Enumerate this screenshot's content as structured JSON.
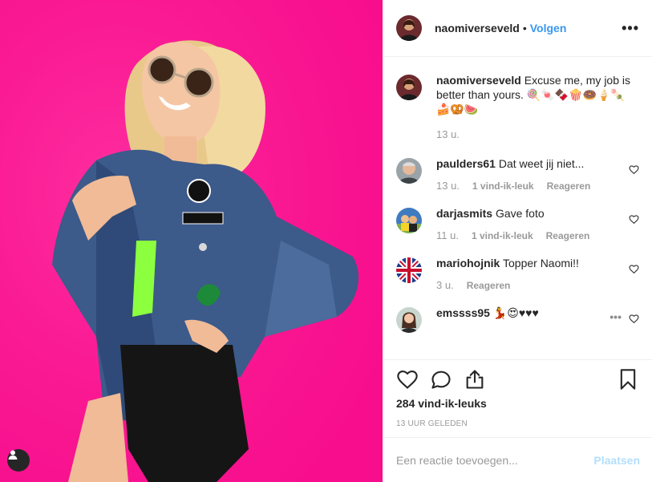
{
  "header": {
    "username": "naomiverseveld",
    "dot": "•",
    "follow_label": "Volgen",
    "more_label": "•••"
  },
  "caption": {
    "username": "naomiverseveld",
    "text": "Excuse me, my job is better than yours. 🍭🍬🍫🍿🍩🍦🍡🍰🥨🍉",
    "time": "13 u."
  },
  "comments": [
    {
      "username": "paulders61",
      "text": "Dat weet jij niet...",
      "time": "13 u.",
      "likes": "1 vind-ik-leuk",
      "reply": "Reageren"
    },
    {
      "username": "darjasmits",
      "text": "Gave foto",
      "time": "11 u.",
      "likes": "1 vind-ik-leuk",
      "reply": "Reageren"
    },
    {
      "username": "mariohojnik",
      "text": "Topper Naomi!!",
      "time": "3 u.",
      "reply": "Reageren"
    },
    {
      "username": "emssss95",
      "text": "💃😍♥♥♥"
    }
  ],
  "comment_more": "•••",
  "likes_text": "284 vind-ik-leuks",
  "timestamp": "13 UUR GELEDEN",
  "add_comment": {
    "placeholder": "Een reactie toevoegen...",
    "post_label": "Plaatsen"
  },
  "icons": {
    "like": "heart-icon",
    "comment": "comment-icon",
    "share": "share-icon",
    "save": "bookmark-icon",
    "tag": "user-icon"
  },
  "colors": {
    "photo_background": "#ff1493",
    "link_blue": "#3897f0",
    "post_disabled": "#b2dffc",
    "border": "#efefef"
  }
}
